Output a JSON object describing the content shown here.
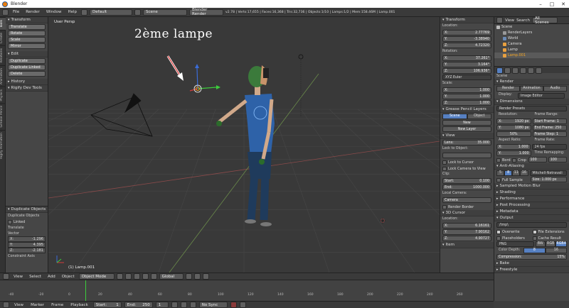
{
  "window": {
    "title": "Blender"
  },
  "info": {
    "menus": [
      "File",
      "Render",
      "Window",
      "Help"
    ],
    "layout": "Default",
    "scene": "Scene",
    "engine": "Blender Render",
    "stats": "v2.78 | Verts:17,655 | Faces:16,368 | Tris:32,736 | Objects:1/10 | Lamps:1/2 | Mem:158.46M | Lamp.001"
  },
  "tabs": [
    "Tools",
    "Create",
    "Relations",
    "Animation",
    "Physics",
    "Grease Pencil",
    "Rigify Animation"
  ],
  "toolshelf": {
    "transform_title": "Transform",
    "transform_buttons": [
      "Translate",
      "Rotate",
      "Scale",
      "Mirror"
    ],
    "edit_title": "Edit",
    "edit_buttons": [
      "Duplicate",
      "Duplicate Linked",
      "Delete"
    ],
    "history": "History",
    "rigify": "Rigify Dev Tools"
  },
  "redo": {
    "title": "Duplicate Objects",
    "sub": "Duplicate Objects",
    "linked": "Linked",
    "translate": "Translate",
    "vector": "Vector",
    "x": "-1.296",
    "y": "4.395",
    "z": "-2.181",
    "constraint": "Constraint Axis"
  },
  "viewport": {
    "label": "User Persp",
    "footer": "(1) Lamp.001",
    "annotation": "2ème lampe"
  },
  "npanel": {
    "transform": "Transform",
    "location": "Location:",
    "loc": [
      "2.77769",
      "-3.38940",
      "4.72320"
    ],
    "rotation": "Rotation:",
    "rot": [
      "37.261°",
      "3.164°",
      "106.936°"
    ],
    "euler": "XYZ Euler",
    "scale": "Scale:",
    "scl": [
      "1.000",
      "1.000",
      "1.000"
    ],
    "grease": "Grease Pencil Layers",
    "gp_tabs": [
      "Scene",
      "Object"
    ],
    "new": "New",
    "new_layer": "New Layer",
    "view": "View",
    "lens": "Lens:",
    "lens_val": "35.000",
    "lock_obj": "Lock to Object:",
    "lock_cursor": "Lock to Cursor",
    "lock_cam": "Lock Camera to View",
    "clip": "Clip:",
    "start": "Start:",
    "start_val": "0.100",
    "end": "End:",
    "end_val": "1000.000",
    "local_cam": "Local Camera:",
    "camera": "Camera",
    "render_border": "Render Border",
    "cursor": "3D Cursor",
    "location2": "Location:",
    "cur": [
      "6.16161",
      "7.90162",
      "4.90727"
    ],
    "item": "Item"
  },
  "outliner": {
    "tabs": [
      "View",
      "Search",
      "All Scenes"
    ],
    "items": [
      "Scene",
      "RenderLayers",
      "World",
      "Camera",
      "Lamp",
      "Lamp.001"
    ]
  },
  "props": {
    "scene": "Scene",
    "render": "Render",
    "render_btns": [
      "Render",
      "Animation",
      "Audio"
    ],
    "display": "Display:",
    "display_val": "Image Editor",
    "dimensions": "Dimensions",
    "presets": "Render Presets",
    "resolution": "Resolution:",
    "res_x": "1920 px",
    "res_y": "1080 px",
    "res_pct": "50%",
    "frame_range": "Frame Range:",
    "fstart": "Start Frame: 1",
    "fend": "End Frame: 250",
    "fstep": "Frame Step: 1",
    "aspect": "Aspect Ratio:",
    "asp_x": "1.000",
    "asp_y": "1.000",
    "frame_rate": "Frame Rate:",
    "fps": "24 fps",
    "remap": "Time Remapping:",
    "remap_a": "100",
    "remap_b": "100",
    "border": "Bord",
    "crop": "Crop",
    "aa": "Anti-Aliasing",
    "aa_vals": [
      "5",
      "8",
      "11",
      "16"
    ],
    "filter": "Mitchell-Netravali",
    "full_sample": "Full Sample",
    "size": "Size: 1.000 px",
    "motion_blur": "Sampled Motion Blur",
    "shading": "Shading",
    "performance": "Performance",
    "post": "Post Processing",
    "metadata": "Metadata",
    "output": "Output",
    "output_path": "/tmp\\",
    "overwrite": "Overwrite",
    "file_ext": "File Extensions",
    "placeholders": "Placeholders",
    "cache": "Cache Result",
    "format": "PNG",
    "bw": "BW",
    "rgb": "RGB",
    "rgba": "RGBA",
    "color_depth": "Color Depth:",
    "cd8": "8",
    "cd16": "16",
    "compression": "Compression:",
    "comp_val": "15%",
    "bake": "Bake",
    "freestyle": "Freestyle"
  },
  "header3d": {
    "menus": [
      "View",
      "Select",
      "Add",
      "Object"
    ],
    "mode": "Object Mode",
    "orient": "Global"
  },
  "timeline": {
    "menus": [
      "View",
      "Marker",
      "Frame",
      "Playback"
    ],
    "start": "Start:",
    "start_val": "1",
    "end": "End:",
    "end_val": "250",
    "current": "1",
    "sync": "No Sync",
    "ticks": [
      "-40",
      "-20",
      "0",
      "20",
      "40",
      "60",
      "80",
      "100",
      "120",
      "140",
      "160",
      "180",
      "200",
      "220",
      "240",
      "260"
    ]
  }
}
